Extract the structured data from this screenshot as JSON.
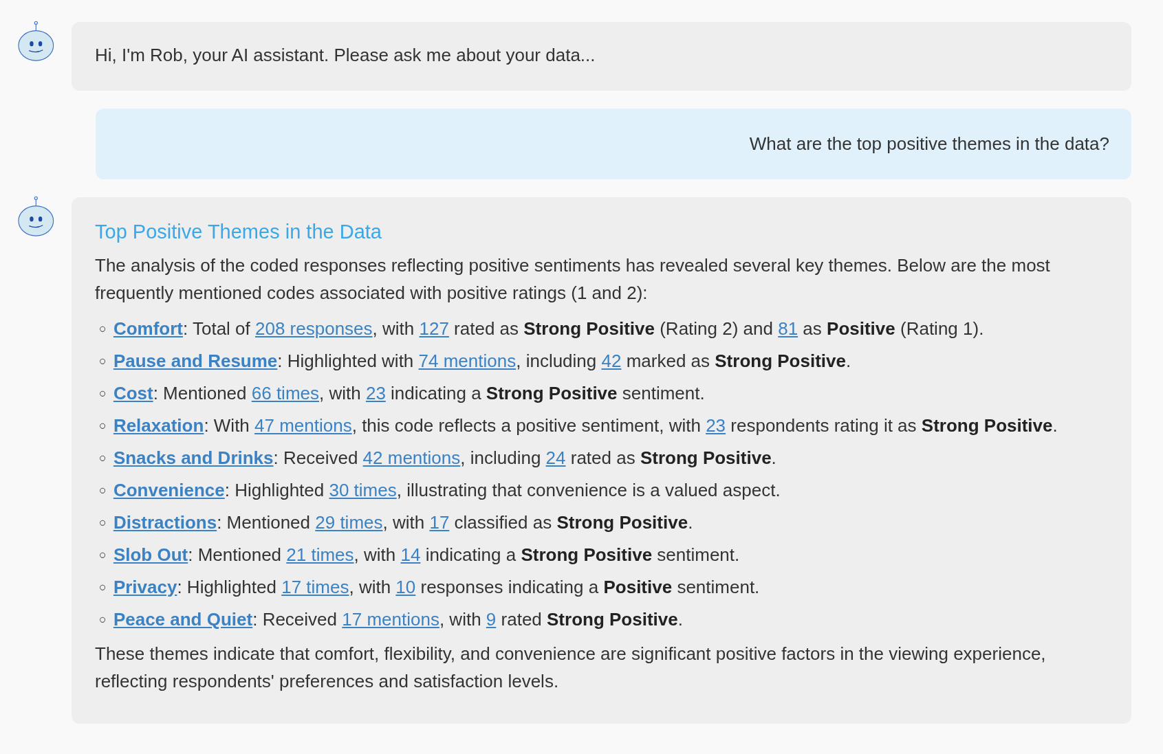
{
  "messages": [
    {
      "kind": "assistant",
      "text": "Hi, I'm Rob, your AI assistant. Please ask me about your data..."
    },
    {
      "kind": "user",
      "text": "What are the top positive themes in the data?"
    },
    {
      "kind": "assistant",
      "title": "Top Positive Themes in the Data",
      "intro": "The analysis of the coded responses reflecting positive sentiments has revealed several key themes. Below are the most frequently mentioned codes associated with positive ratings (1 and 2):",
      "items": [
        {
          "bullet": "○",
          "parts": [
            {
              "kind": "code",
              "text": "Comfort"
            },
            {
              "kind": "plain",
              "text": ": Total of "
            },
            {
              "kind": "link",
              "text": "208 responses"
            },
            {
              "kind": "plain",
              "text": ", with "
            },
            {
              "kind": "link",
              "text": "127"
            },
            {
              "kind": "plain",
              "text": " rated as "
            },
            {
              "kind": "bold",
              "text": "Strong Positive"
            },
            {
              "kind": "plain",
              "text": " (Rating 2) and "
            },
            {
              "kind": "link",
              "text": "81"
            },
            {
              "kind": "plain",
              "text": " as "
            },
            {
              "kind": "bold",
              "text": "Positive"
            },
            {
              "kind": "plain",
              "text": " (Rating 1)."
            }
          ]
        },
        {
          "bullet": "○",
          "parts": [
            {
              "kind": "code",
              "text": "Pause and Resume"
            },
            {
              "kind": "plain",
              "text": ": Highlighted with "
            },
            {
              "kind": "link",
              "text": "74 mentions"
            },
            {
              "kind": "plain",
              "text": ", including "
            },
            {
              "kind": "link",
              "text": "42"
            },
            {
              "kind": "plain",
              "text": " marked as "
            },
            {
              "kind": "bold",
              "text": "Strong Positive"
            },
            {
              "kind": "plain",
              "text": "."
            }
          ]
        },
        {
          "bullet": "○",
          "parts": [
            {
              "kind": "code",
              "text": "Cost"
            },
            {
              "kind": "plain",
              "text": ": Mentioned "
            },
            {
              "kind": "link",
              "text": "66 times"
            },
            {
              "kind": "plain",
              "text": ", with "
            },
            {
              "kind": "link",
              "text": "23"
            },
            {
              "kind": "plain",
              "text": " indicating a "
            },
            {
              "kind": "bold",
              "text": "Strong Positive"
            },
            {
              "kind": "plain",
              "text": " sentiment."
            }
          ]
        },
        {
          "bullet": "○",
          "parts": [
            {
              "kind": "code",
              "text": "Relaxation"
            },
            {
              "kind": "plain",
              "text": ": With "
            },
            {
              "kind": "link",
              "text": "47 mentions"
            },
            {
              "kind": "plain",
              "text": ", this code reflects a positive sentiment, with "
            },
            {
              "kind": "link",
              "text": "23"
            },
            {
              "kind": "plain",
              "text": " respondents rating it as "
            },
            {
              "kind": "bold",
              "text": "Strong Positive"
            },
            {
              "kind": "plain",
              "text": "."
            }
          ]
        },
        {
          "bullet": "○",
          "parts": [
            {
              "kind": "code",
              "text": "Snacks and Drinks"
            },
            {
              "kind": "plain",
              "text": ": Received "
            },
            {
              "kind": "link",
              "text": "42 mentions"
            },
            {
              "kind": "plain",
              "text": ", including "
            },
            {
              "kind": "link",
              "text": "24"
            },
            {
              "kind": "plain",
              "text": " rated as "
            },
            {
              "kind": "bold",
              "text": "Strong Positive"
            },
            {
              "kind": "plain",
              "text": "."
            }
          ]
        },
        {
          "bullet": "○",
          "parts": [
            {
              "kind": "code",
              "text": "Convenience"
            },
            {
              "kind": "plain",
              "text": ": Highlighted "
            },
            {
              "kind": "link",
              "text": "30 times"
            },
            {
              "kind": "plain",
              "text": ", illustrating that convenience is a valued aspect."
            }
          ]
        },
        {
          "bullet": "○",
          "parts": [
            {
              "kind": "code",
              "text": "Distractions"
            },
            {
              "kind": "plain",
              "text": ": Mentioned "
            },
            {
              "kind": "link",
              "text": "29 times"
            },
            {
              "kind": "plain",
              "text": ", with "
            },
            {
              "kind": "link",
              "text": "17"
            },
            {
              "kind": "plain",
              "text": " classified as "
            },
            {
              "kind": "bold",
              "text": "Strong Positive"
            },
            {
              "kind": "plain",
              "text": "."
            }
          ]
        },
        {
          "bullet": "○",
          "parts": [
            {
              "kind": "code",
              "text": "Slob Out"
            },
            {
              "kind": "plain",
              "text": ": Mentioned "
            },
            {
              "kind": "link",
              "text": "21 times"
            },
            {
              "kind": "plain",
              "text": ", with "
            },
            {
              "kind": "link",
              "text": "14"
            },
            {
              "kind": "plain",
              "text": " indicating a "
            },
            {
              "kind": "bold",
              "text": "Strong Positive"
            },
            {
              "kind": "plain",
              "text": " sentiment."
            }
          ]
        },
        {
          "bullet": "○",
          "parts": [
            {
              "kind": "code",
              "text": "Privacy"
            },
            {
              "kind": "plain",
              "text": ": Highlighted "
            },
            {
              "kind": "link",
              "text": "17 times"
            },
            {
              "kind": "plain",
              "text": ", with "
            },
            {
              "kind": "link",
              "text": "10"
            },
            {
              "kind": "plain",
              "text": " responses indicating a "
            },
            {
              "kind": "bold",
              "text": "Positive"
            },
            {
              "kind": "plain",
              "text": " sentiment."
            }
          ]
        },
        {
          "bullet": "○",
          "parts": [
            {
              "kind": "code",
              "text": "Peace and Quiet"
            },
            {
              "kind": "plain",
              "text": ": Received "
            },
            {
              "kind": "link",
              "text": "17 mentions"
            },
            {
              "kind": "plain",
              "text": ", with "
            },
            {
              "kind": "link",
              "text": "9"
            },
            {
              "kind": "plain",
              "text": " rated "
            },
            {
              "kind": "bold",
              "text": "Strong Positive"
            },
            {
              "kind": "plain",
              "text": "."
            }
          ]
        }
      ],
      "outro": "These themes indicate that comfort, flexibility, and convenience are significant positive factors in the viewing experience, reflecting respondents' preferences and satisfaction levels."
    }
  ]
}
